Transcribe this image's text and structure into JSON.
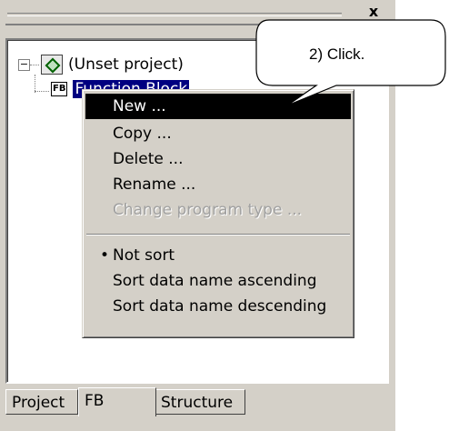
{
  "window": {
    "close_glyph": "x"
  },
  "tree": {
    "root": {
      "expander": "−",
      "icon": "project-icon",
      "label": "(Unset project)"
    },
    "child": {
      "icon_text": "FB",
      "label": "Function Block"
    }
  },
  "context_menu": {
    "items": [
      {
        "label": "New ..."
      },
      {
        "label": "Copy ..."
      },
      {
        "label": "Delete ..."
      },
      {
        "label": "Rename ..."
      },
      {
        "label": "Change program type ..."
      },
      {
        "label": "Not sort",
        "bullet": "•"
      },
      {
        "label": "Sort data name ascending"
      },
      {
        "label": "Sort data name descending"
      }
    ]
  },
  "tabs": [
    {
      "label": "Project"
    },
    {
      "label": "FB"
    },
    {
      "label": "Structure"
    }
  ],
  "callout": {
    "text": "2) Click."
  },
  "colors": {
    "highlight": "#000000",
    "selection": "#000080",
    "panel": "#d4d0c8"
  }
}
